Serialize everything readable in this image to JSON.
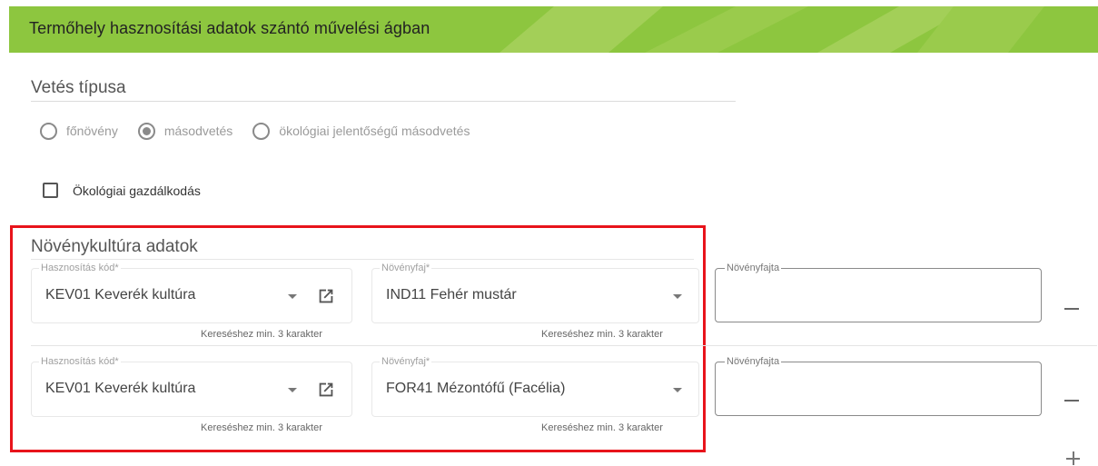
{
  "banner": {
    "title": "Termőhely hasznosítási adatok szántó művelési ágban",
    "color": "#8dc63f",
    "accent_color": "#a9d25e"
  },
  "seeding": {
    "title": "Vetés típusa",
    "options": [
      {
        "label": "főnövény",
        "selected": false
      },
      {
        "label": "másodvetés",
        "selected": true
      },
      {
        "label": "ökológiai jelentőségű másodvetés",
        "selected": false
      }
    ]
  },
  "ecological": {
    "label": "Ökológiai gazdálkodás",
    "checked": false
  },
  "crops": {
    "title": "Növénykultúra adatok",
    "rows": [
      {
        "usage_label": "Hasznosítás kód*",
        "usage_value": "KEV01 Keverék kultúra",
        "usage_hint": "Kereséshez min. 3 karakter",
        "species_label": "Növényfaj*",
        "species_value": "IND11 Fehér mustár",
        "species_hint": "Kereséshez min. 3 karakter",
        "variety_label": "Növényfajta",
        "variety_value": ""
      },
      {
        "usage_label": "Hasznosítás kód*",
        "usage_value": "KEV01 Keverék kultúra",
        "usage_hint": "Kereséshez min. 3 karakter",
        "species_label": "Növényfaj*",
        "species_value": "FOR41 Mézontófű (Facélia)",
        "species_hint": "Kereséshez min. 3 karakter",
        "variety_label": "Növényfajta",
        "variety_value": ""
      }
    ]
  },
  "highlight_color": "#e8141b",
  "icons": {
    "open": "open-in-new-icon",
    "caret": "chevron-down-icon",
    "remove": "minus-icon",
    "add": "plus-icon"
  }
}
